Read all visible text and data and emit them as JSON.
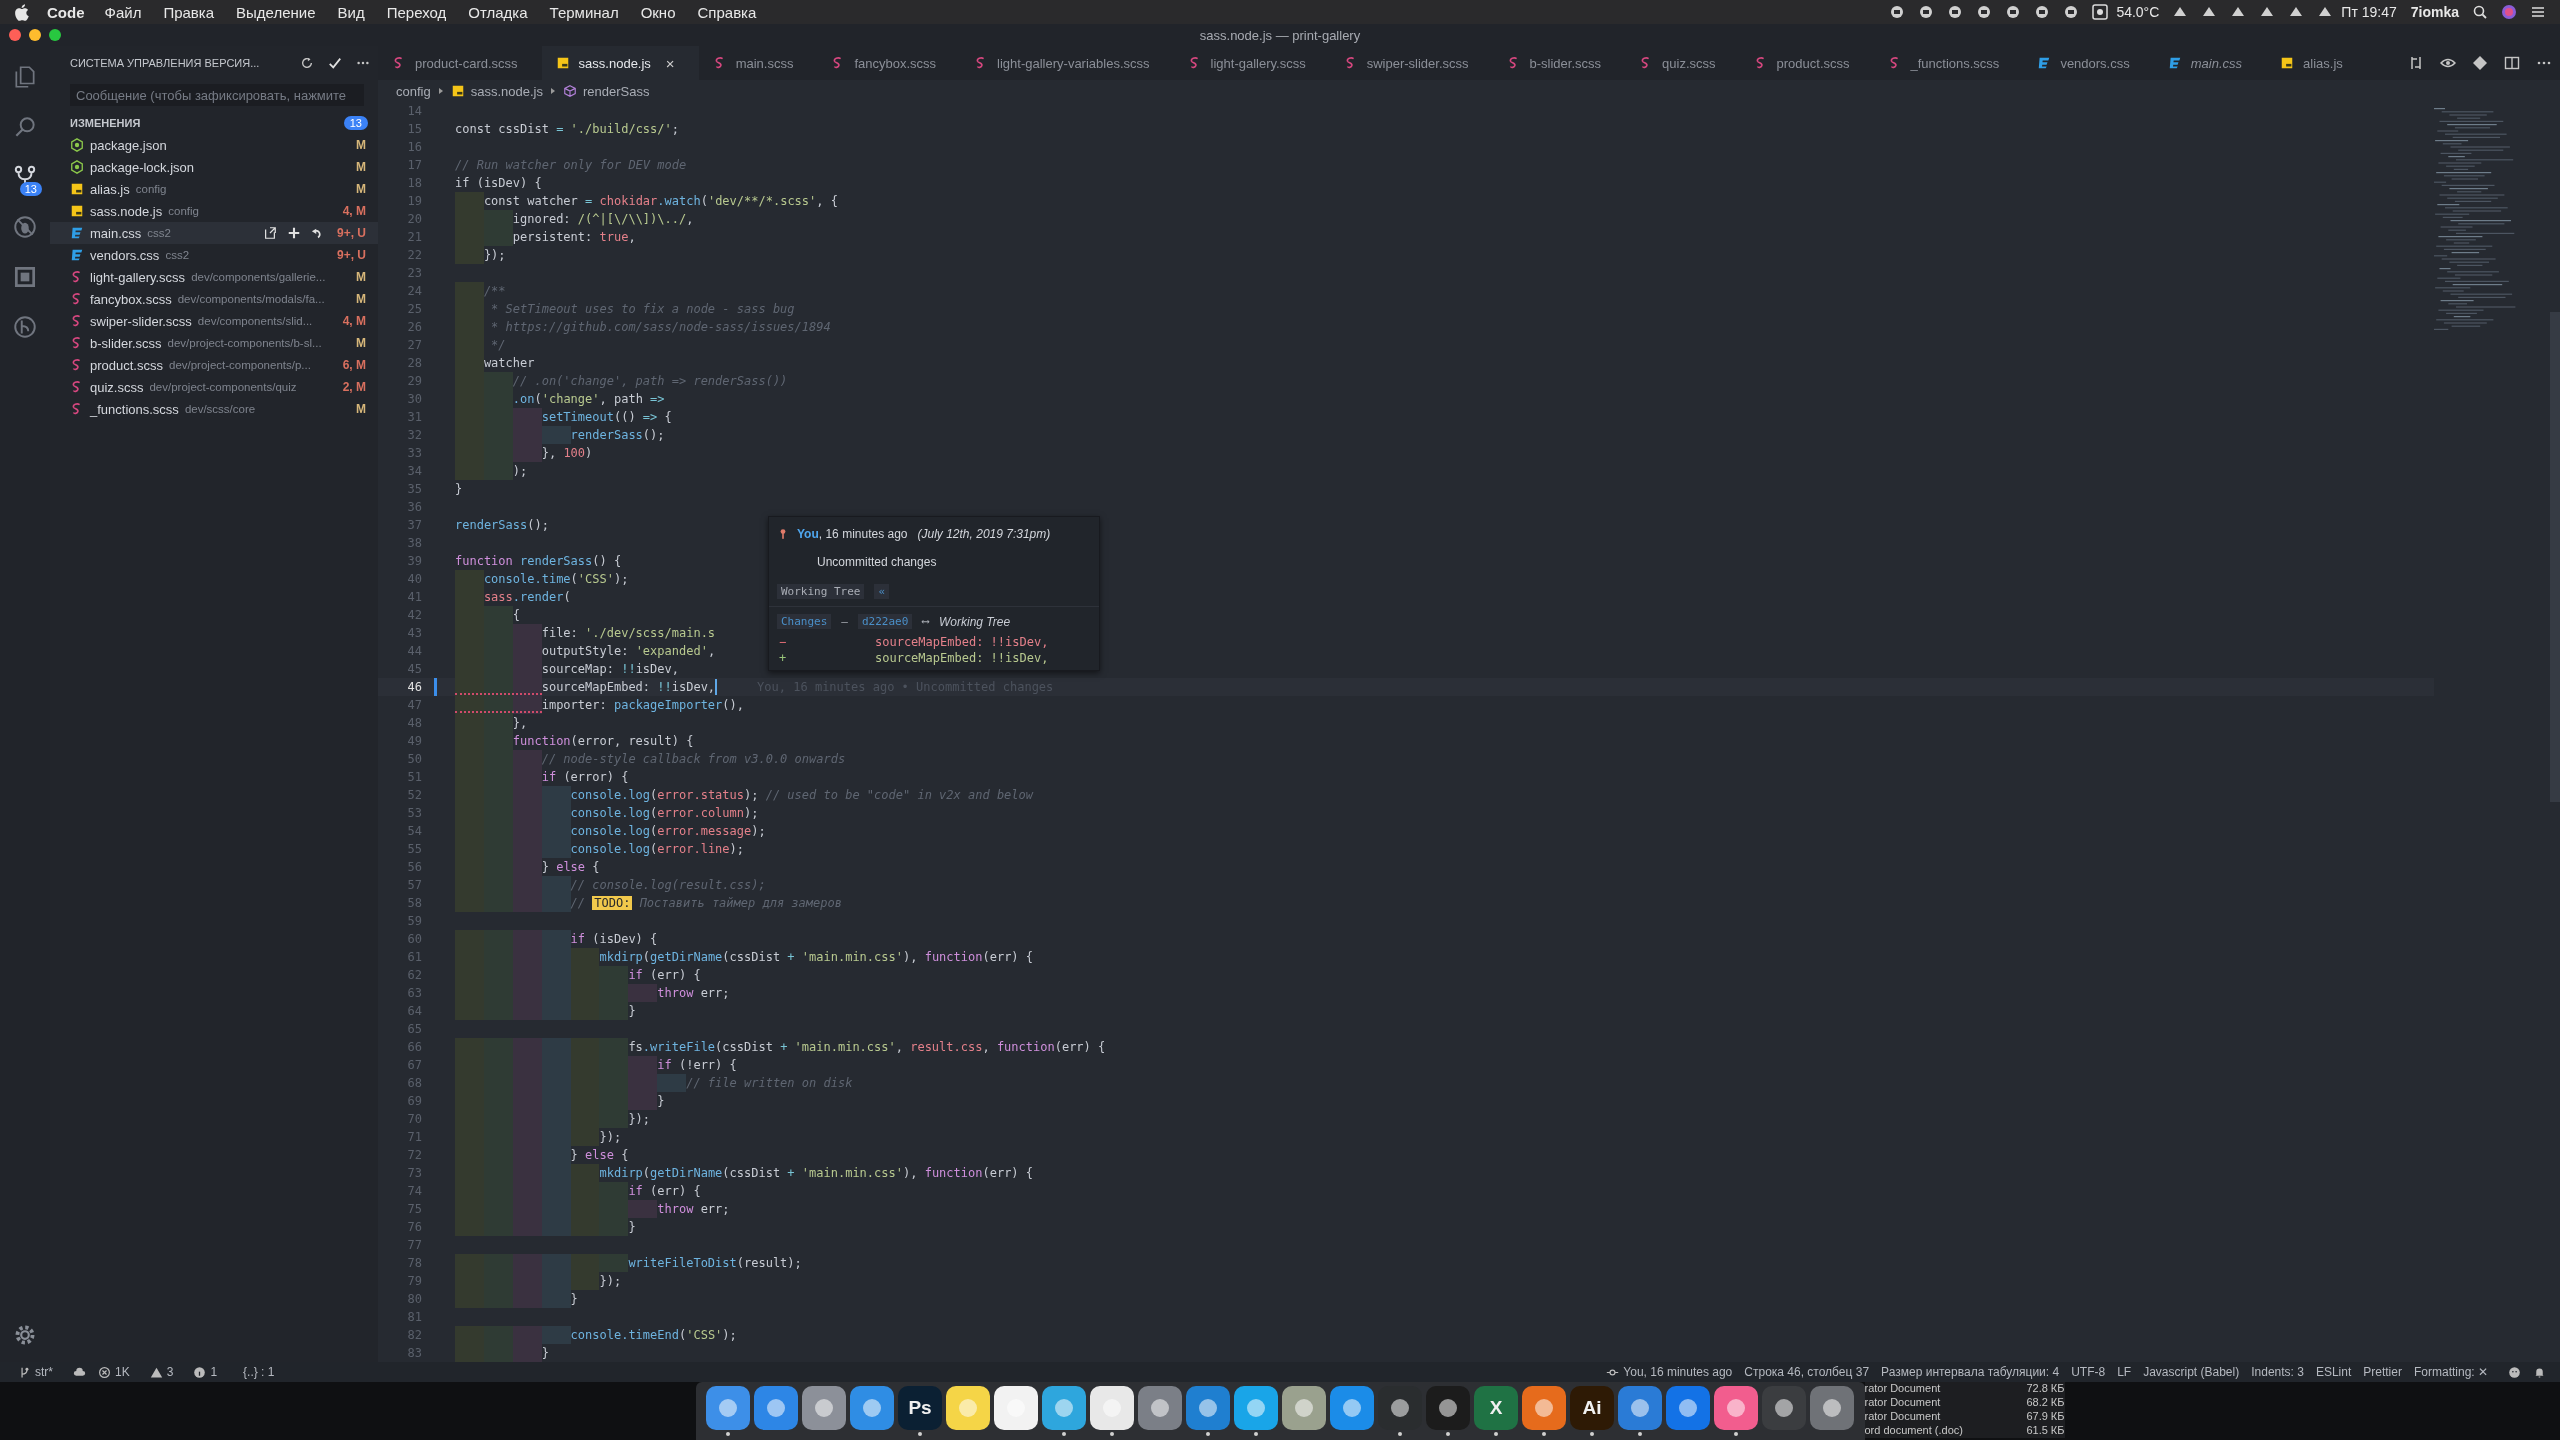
{
  "menubar": {
    "app": "Code",
    "menus": [
      "Файл",
      "Правка",
      "Выделение",
      "Вид",
      "Переход",
      "Отладка",
      "Терминал",
      "Окно",
      "Справка"
    ],
    "temperature": "54.0°C",
    "clock": "Пт 19:47",
    "user": "7iomka"
  },
  "window": {
    "title": "sass.node.js — print-gallery"
  },
  "activity_bar": {
    "items": [
      {
        "kind": "files",
        "selected": false
      },
      {
        "kind": "search",
        "selected": false
      },
      {
        "kind": "scm",
        "selected": true,
        "badge": "13"
      },
      {
        "kind": "debug",
        "selected": false
      },
      {
        "kind": "extensions",
        "selected": false
      },
      {
        "kind": "history",
        "selected": false
      }
    ]
  },
  "sidebar": {
    "title": "СИСТЕМА УПРАВЛЕНИЯ ВЕРСИЯ...",
    "message": {
      "placeholder": "Сообщение (чтобы зафиксировать, нажмите"
    },
    "section": {
      "title": "ИЗМЕНЕНИЯ",
      "count": "13"
    },
    "files": [
      {
        "name": "package.json",
        "status": "M",
        "kind": "json",
        "color": "#d7b77a",
        "selected": false
      },
      {
        "name": "package-lock.json",
        "status": "M",
        "kind": "json",
        "color": "#d7b77a",
        "selected": false
      },
      {
        "name": "alias.js",
        "path": "config",
        "status": "M",
        "kind": "js",
        "color": "#d7b77a",
        "selected": false
      },
      {
        "name": "sass.node.js",
        "path": "config",
        "status": "4, M",
        "kind": "js",
        "color": "#d9705f",
        "selected": false
      },
      {
        "name": "main.css",
        "path": "css2",
        "status": "9+, U",
        "kind": "css",
        "color": "#d9705f",
        "selected": true
      },
      {
        "name": "vendors.css",
        "path": "css2",
        "status": "9+, U",
        "kind": "css",
        "color": "#d9705f",
        "selected": false
      },
      {
        "name": "light-gallery.scss",
        "path": "dev/components/gallerie...",
        "status": "M",
        "kind": "scss",
        "color": "#d7b77a",
        "selected": false
      },
      {
        "name": "fancybox.scss",
        "path": "dev/components/modals/fa...",
        "status": "M",
        "kind": "scss",
        "color": "#d7b77a",
        "selected": false
      },
      {
        "name": "swiper-slider.scss",
        "path": "dev/components/slid...",
        "status": "4, M",
        "kind": "scss",
        "color": "#d9705f",
        "selected": false
      },
      {
        "name": "b-slider.scss",
        "path": "dev/project-components/b-sl...",
        "status": "M",
        "kind": "scss",
        "color": "#d7b77a",
        "selected": false
      },
      {
        "name": "product.scss",
        "path": "dev/project-components/p...",
        "status": "6, M",
        "kind": "scss",
        "color": "#d9705f",
        "selected": false
      },
      {
        "name": "quiz.scss",
        "path": "dev/project-components/quiz",
        "status": "2, M",
        "kind": "scss",
        "color": "#d9705f",
        "selected": false
      },
      {
        "name": "_functions.scss",
        "path": "dev/scss/core",
        "status": "M",
        "kind": "scss",
        "color": "#d7b77a",
        "selected": false
      }
    ]
  },
  "tabs": [
    {
      "label": "product-card.scss",
      "kind": "scss",
      "selected": false,
      "preview": false
    },
    {
      "label": "sass.node.js",
      "kind": "js",
      "selected": true,
      "preview": false,
      "close": "×"
    },
    {
      "label": "main.scss",
      "kind": "scss",
      "selected": false,
      "preview": false
    },
    {
      "label": "fancybox.scss",
      "kind": "scss",
      "selected": false,
      "preview": false
    },
    {
      "label": "light-gallery-variables.scss",
      "kind": "scss",
      "selected": false,
      "preview": false
    },
    {
      "label": "light-gallery.scss",
      "kind": "scss",
      "selected": false,
      "preview": false
    },
    {
      "label": "swiper-slider.scss",
      "kind": "scss",
      "selected": false,
      "preview": false
    },
    {
      "label": "b-slider.scss",
      "kind": "scss",
      "selected": false,
      "preview": false
    },
    {
      "label": "quiz.scss",
      "kind": "scss",
      "selected": false,
      "preview": false
    },
    {
      "label": "product.scss",
      "kind": "scss",
      "selected": false,
      "preview": false
    },
    {
      "label": "_functions.scss",
      "kind": "scss",
      "selected": false,
      "preview": false
    },
    {
      "label": "vendors.css",
      "kind": "css",
      "selected": false,
      "preview": false
    },
    {
      "label": "main.css",
      "kind": "css",
      "selected": false,
      "preview": true
    },
    {
      "label": "alias.js",
      "kind": "js",
      "selected": false,
      "preview": false
    }
  ],
  "breadcrumbs": [
    {
      "label": "config",
      "kind": "folder"
    },
    {
      "label": "sass.node.js",
      "kind": "js"
    },
    {
      "label": "renderSass",
      "kind": "method"
    }
  ],
  "editor": {
    "blame": "You, 16 minutes ago • Uncommitted changes",
    "lines": [
      {
        "n": "14",
        "current": false,
        "squiggle": false
      },
      {
        "n": "15",
        "current": false,
        "squiggle": false,
        "tokens": [
          {
            "kind": "plain",
            "text": "const cssDist "
          },
          {
            "kind": "operator",
            "text": "="
          },
          {
            "kind": "string",
            "text": " './build/css/'"
          },
          {
            "kind": "plain",
            "text": ";"
          }
        ]
      },
      {
        "n": "16",
        "current": false,
        "squiggle": false
      },
      {
        "n": "17",
        "current": false,
        "squiggle": false,
        "tokens": [
          {
            "kind": "comment",
            "text": "// Run watcher only for DEV mode"
          }
        ]
      },
      {
        "n": "18",
        "current": false,
        "squiggle": false,
        "tokens": [
          {
            "kind": "plain",
            "text": "if (isDev) {"
          }
        ]
      },
      {
        "n": "19",
        "current": false,
        "squiggle": false,
        "tokens": [
          {
            "kind": "plain",
            "text": "    const watcher "
          },
          {
            "kind": "operator",
            "text": "="
          },
          {
            "kind": "variable",
            "text": " chokidar"
          },
          {
            "kind": "function",
            "text": ".watch"
          },
          {
            "kind": "plain",
            "text": "("
          },
          {
            "kind": "string",
            "text": "'dev/**/*.scss'"
          },
          {
            "kind": "plain",
            "text": ", {"
          }
        ]
      },
      {
        "n": "20",
        "current": false,
        "squiggle": false,
        "tokens": [
          {
            "kind": "plain",
            "text": "        ignored: "
          },
          {
            "kind": "string",
            "text": "/(^|[\\/\\\\])\\../"
          },
          {
            "kind": "plain",
            "text": ","
          }
        ]
      },
      {
        "n": "21",
        "current": false,
        "squiggle": false,
        "tokens": [
          {
            "kind": "plain",
            "text": "        persistent: "
          },
          {
            "kind": "variable",
            "text": "true"
          },
          {
            "kind": "plain",
            "text": ","
          }
        ]
      },
      {
        "n": "22",
        "current": false,
        "squiggle": false,
        "tokens": [
          {
            "kind": "plain",
            "text": "    });"
          }
        ]
      },
      {
        "n": "23",
        "current": false,
        "squiggle": false
      },
      {
        "n": "24",
        "current": false,
        "squiggle": false,
        "tokens": [
          {
            "kind": "comment",
            "text": "    /**"
          }
        ]
      },
      {
        "n": "25",
        "current": false,
        "squiggle": false,
        "tokens": [
          {
            "kind": "comment",
            "text": "     * SetTimeout uses to fix a node - sass bug"
          }
        ]
      },
      {
        "n": "26",
        "current": false,
        "squiggle": false,
        "tokens": [
          {
            "kind": "comment",
            "text": "     * https://github.com/sass/node-sass/issues/1894"
          }
        ]
      },
      {
        "n": "27",
        "current": false,
        "squiggle": false,
        "tokens": [
          {
            "kind": "comment",
            "text": "     */"
          }
        ]
      },
      {
        "n": "28",
        "current": false,
        "squiggle": false,
        "tokens": [
          {
            "kind": "plain",
            "text": "    watcher"
          }
        ]
      },
      {
        "n": "29",
        "current": false,
        "squiggle": false,
        "tokens": [
          {
            "kind": "comment",
            "text": "        // .on('change', path => renderSass())"
          }
        ]
      },
      {
        "n": "30",
        "current": false,
        "squiggle": false,
        "tokens": [
          {
            "kind": "function",
            "text": "        .on"
          },
          {
            "kind": "plain",
            "text": "("
          },
          {
            "kind": "string",
            "text": "'change'"
          },
          {
            "kind": "plain",
            "text": ", path "
          },
          {
            "kind": "operator",
            "text": "=>"
          }
        ]
      },
      {
        "n": "31",
        "current": false,
        "squiggle": false,
        "tokens": [
          {
            "kind": "function",
            "text": "            setTimeout"
          },
          {
            "kind": "plain",
            "text": "(() "
          },
          {
            "kind": "operator",
            "text": "=>"
          },
          {
            "kind": "plain",
            "text": " {"
          }
        ]
      },
      {
        "n": "32",
        "current": false,
        "squiggle": false,
        "tokens": [
          {
            "kind": "function",
            "text": "                renderSass"
          },
          {
            "kind": "plain",
            "text": "();"
          }
        ]
      },
      {
        "n": "33",
        "current": false,
        "squiggle": false,
        "tokens": [
          {
            "kind": "plain",
            "text": "            }, "
          },
          {
            "kind": "variable",
            "text": "100"
          },
          {
            "kind": "plain",
            "text": ")"
          }
        ]
      },
      {
        "n": "34",
        "current": false,
        "squiggle": false,
        "tokens": [
          {
            "kind": "plain",
            "text": "        );"
          }
        ]
      },
      {
        "n": "35",
        "current": false,
        "squiggle": false,
        "tokens": [
          {
            "kind": "plain",
            "text": "}"
          }
        ]
      },
      {
        "n": "36",
        "current": false,
        "squiggle": false
      },
      {
        "n": "37",
        "current": false,
        "squiggle": false,
        "tokens": [
          {
            "kind": "function",
            "text": "renderSass"
          },
          {
            "kind": "plain",
            "text": "();"
          }
        ]
      },
      {
        "n": "38",
        "current": false,
        "squiggle": false
      },
      {
        "n": "39",
        "current": false,
        "squiggle": false,
        "tokens": [
          {
            "kind": "keyword",
            "text": "function"
          },
          {
            "kind": "function",
            "text": " renderSass"
          },
          {
            "kind": "plain",
            "text": "() {"
          }
        ]
      },
      {
        "n": "40",
        "current": false,
        "squiggle": false,
        "tokens": [
          {
            "kind": "function",
            "text": "    console.time"
          },
          {
            "kind": "plain",
            "text": "("
          },
          {
            "kind": "string",
            "text": "'CSS'"
          },
          {
            "kind": "plain",
            "text": ");"
          }
        ]
      },
      {
        "n": "41",
        "current": false,
        "squiggle": false,
        "tokens": [
          {
            "kind": "variable",
            "text": "    sass"
          },
          {
            "kind": "function",
            "text": ".render"
          },
          {
            "kind": "plain",
            "text": "("
          }
        ]
      },
      {
        "n": "42",
        "current": false,
        "squiggle": false,
        "tokens": [
          {
            "kind": "plain",
            "text": "        {"
          }
        ]
      },
      {
        "n": "43",
        "current": false,
        "squiggle": false,
        "tokens": [
          {
            "kind": "plain",
            "text": "            file: "
          },
          {
            "kind": "string",
            "text": "'./dev/scss/main.s"
          }
        ]
      },
      {
        "n": "44",
        "current": false,
        "squiggle": false,
        "tokens": [
          {
            "kind": "plain",
            "text": "            outputStyle: "
          },
          {
            "kind": "string",
            "text": "'expanded'"
          },
          {
            "kind": "plain",
            "text": ","
          }
        ]
      },
      {
        "n": "45",
        "current": false,
        "squiggle": false,
        "tokens": [
          {
            "kind": "plain",
            "text": "            sourceMap: "
          },
          {
            "kind": "operator",
            "text": "!!"
          },
          {
            "kind": "plain",
            "text": "isDev,"
          }
        ]
      },
      {
        "n": "46",
        "current": true,
        "squiggle": true,
        "tokens": [
          {
            "kind": "plain",
            "text": "            sourceMapEmbed: "
          },
          {
            "kind": "operator",
            "text": "!!"
          },
          {
            "kind": "plain",
            "text": "isDev,"
          }
        ]
      },
      {
        "n": "47",
        "current": false,
        "squiggle": true,
        "tokens": [
          {
            "kind": "plain",
            "text": "            importer: "
          },
          {
            "kind": "function",
            "text": "packageImporter"
          },
          {
            "kind": "plain",
            "text": "(),"
          }
        ]
      },
      {
        "n": "48",
        "current": false,
        "squiggle": false,
        "tokens": [
          {
            "kind": "plain",
            "text": "        },"
          }
        ]
      },
      {
        "n": "49",
        "current": false,
        "squiggle": false,
        "tokens": [
          {
            "kind": "keyword",
            "text": "        function"
          },
          {
            "kind": "plain",
            "text": "(error, result) {"
          }
        ]
      },
      {
        "n": "50",
        "current": false,
        "squiggle": false,
        "tokens": [
          {
            "kind": "comment",
            "text": "            // node-style callback from v3.0.0 onwards"
          }
        ]
      },
      {
        "n": "51",
        "current": false,
        "squiggle": false,
        "tokens": [
          {
            "kind": "keyword",
            "text": "            if"
          },
          {
            "kind": "plain",
            "text": " (error) {"
          }
        ]
      },
      {
        "n": "52",
        "current": false,
        "squiggle": false,
        "tokens": [
          {
            "kind": "function",
            "text": "                console.log"
          },
          {
            "kind": "plain",
            "text": "("
          },
          {
            "kind": "variable",
            "text": "error.status"
          },
          {
            "kind": "plain",
            "text": ");"
          },
          {
            "kind": "comment",
            "text": " // used to be \"code\" in v2x and below"
          }
        ]
      },
      {
        "n": "53",
        "current": false,
        "squiggle": false,
        "tokens": [
          {
            "kind": "function",
            "text": "                console.log"
          },
          {
            "kind": "plain",
            "text": "("
          },
          {
            "kind": "variable",
            "text": "error.column"
          },
          {
            "kind": "plain",
            "text": ");"
          }
        ]
      },
      {
        "n": "54",
        "current": false,
        "squiggle": false,
        "tokens": [
          {
            "kind": "function",
            "text": "                console.log"
          },
          {
            "kind": "plain",
            "text": "("
          },
          {
            "kind": "variable",
            "text": "error.message"
          },
          {
            "kind": "plain",
            "text": ");"
          }
        ]
      },
      {
        "n": "55",
        "current": false,
        "squiggle": false,
        "tokens": [
          {
            "kind": "function",
            "text": "                console.log"
          },
          {
            "kind": "plain",
            "text": "("
          },
          {
            "kind": "variable",
            "text": "error.line"
          },
          {
            "kind": "plain",
            "text": ");"
          }
        ]
      },
      {
        "n": "56",
        "current": false,
        "squiggle": false,
        "tokens": [
          {
            "kind": "plain",
            "text": "            } "
          },
          {
            "kind": "keyword",
            "text": "else"
          },
          {
            "kind": "plain",
            "text": " {"
          }
        ]
      },
      {
        "n": "57",
        "current": false,
        "squiggle": false,
        "tokens": [
          {
            "kind": "comment",
            "text": "                // console.log(result.css);"
          }
        ]
      },
      {
        "n": "58",
        "current": false,
        "squiggle": false,
        "tokens": [
          {
            "kind": "comment",
            "text": "                // "
          },
          {
            "kind": "todo",
            "text": "TODO:"
          },
          {
            "kind": "comment",
            "text": " Поставить таймер для замеров"
          }
        ]
      },
      {
        "n": "59",
        "current": false,
        "squiggle": false
      },
      {
        "n": "60",
        "current": false,
        "squiggle": false,
        "tokens": [
          {
            "kind": "keyword",
            "text": "                if"
          },
          {
            "kind": "plain",
            "text": " (isDev) {"
          }
        ]
      },
      {
        "n": "61",
        "current": false,
        "squiggle": false,
        "tokens": [
          {
            "kind": "function",
            "text": "                    mkdirp"
          },
          {
            "kind": "plain",
            "text": "("
          },
          {
            "kind": "function",
            "text": "getDirName"
          },
          {
            "kind": "plain",
            "text": "(cssDist "
          },
          {
            "kind": "operator",
            "text": "+"
          },
          {
            "kind": "string",
            "text": " 'main.min.css'"
          },
          {
            "kind": "plain",
            "text": "), "
          },
          {
            "kind": "keyword",
            "text": "function"
          },
          {
            "kind": "plain",
            "text": "(err) {"
          }
        ]
      },
      {
        "n": "62",
        "current": false,
        "squiggle": false,
        "tokens": [
          {
            "kind": "keyword",
            "text": "                        if"
          },
          {
            "kind": "plain",
            "text": " (err) {"
          }
        ]
      },
      {
        "n": "63",
        "current": false,
        "squiggle": false,
        "tokens": [
          {
            "kind": "keyword",
            "text": "                            throw"
          },
          {
            "kind": "plain",
            "text": " err;"
          }
        ]
      },
      {
        "n": "64",
        "current": false,
        "squiggle": false,
        "tokens": [
          {
            "kind": "plain",
            "text": "                        }"
          }
        ]
      },
      {
        "n": "65",
        "current": false,
        "squiggle": false
      },
      {
        "n": "66",
        "current": false,
        "squiggle": false,
        "tokens": [
          {
            "kind": "plain",
            "text": "                        fs"
          },
          {
            "kind": "function",
            "text": ".writeFile"
          },
          {
            "kind": "plain",
            "text": "(cssDist "
          },
          {
            "kind": "operator",
            "text": "+"
          },
          {
            "kind": "string",
            "text": " 'main.min.css'"
          },
          {
            "kind": "plain",
            "text": ", "
          },
          {
            "kind": "variable",
            "text": "result.css"
          },
          {
            "kind": "plain",
            "text": ", "
          },
          {
            "kind": "keyword",
            "text": "function"
          },
          {
            "kind": "plain",
            "text": "(err) {"
          }
        ]
      },
      {
        "n": "67",
        "current": false,
        "squiggle": false,
        "tokens": [
          {
            "kind": "keyword",
            "text": "                            if"
          },
          {
            "kind": "plain",
            "text": " (!err) {"
          }
        ]
      },
      {
        "n": "68",
        "current": false,
        "squiggle": false,
        "tokens": [
          {
            "kind": "comment",
            "text": "                                // file written on disk"
          }
        ]
      },
      {
        "n": "69",
        "current": false,
        "squiggle": false,
        "tokens": [
          {
            "kind": "plain",
            "text": "                            }"
          }
        ]
      },
      {
        "n": "70",
        "current": false,
        "squiggle": false,
        "tokens": [
          {
            "kind": "plain",
            "text": "                        });"
          }
        ]
      },
      {
        "n": "71",
        "current": false,
        "squiggle": false,
        "tokens": [
          {
            "kind": "plain",
            "text": "                    });"
          }
        ]
      },
      {
        "n": "72",
        "current": false,
        "squiggle": false,
        "tokens": [
          {
            "kind": "plain",
            "text": "                } "
          },
          {
            "kind": "keyword",
            "text": "else"
          },
          {
            "kind": "plain",
            "text": " {"
          }
        ]
      },
      {
        "n": "73",
        "current": false,
        "squiggle": false,
        "tokens": [
          {
            "kind": "function",
            "text": "                    mkdirp"
          },
          {
            "kind": "plain",
            "text": "("
          },
          {
            "kind": "function",
            "text": "getDirName"
          },
          {
            "kind": "plain",
            "text": "(cssDist "
          },
          {
            "kind": "operator",
            "text": "+"
          },
          {
            "kind": "string",
            "text": " 'main.min.css'"
          },
          {
            "kind": "plain",
            "text": "), "
          },
          {
            "kind": "keyword",
            "text": "function"
          },
          {
            "kind": "plain",
            "text": "(err) {"
          }
        ]
      },
      {
        "n": "74",
        "current": false,
        "squiggle": false,
        "tokens": [
          {
            "kind": "keyword",
            "text": "                        if"
          },
          {
            "kind": "plain",
            "text": " (err) {"
          }
        ]
      },
      {
        "n": "75",
        "current": false,
        "squiggle": false,
        "tokens": [
          {
            "kind": "keyword",
            "text": "                            throw"
          },
          {
            "kind": "plain",
            "text": " err;"
          }
        ]
      },
      {
        "n": "76",
        "current": false,
        "squiggle": false,
        "tokens": [
          {
            "kind": "plain",
            "text": "                        }"
          }
        ]
      },
      {
        "n": "77",
        "current": false,
        "squiggle": false
      },
      {
        "n": "78",
        "current": false,
        "squiggle": false,
        "tokens": [
          {
            "kind": "function",
            "text": "                        writeFileToDist"
          },
          {
            "kind": "plain",
            "text": "(result);"
          }
        ]
      },
      {
        "n": "79",
        "current": false,
        "squiggle": false,
        "tokens": [
          {
            "kind": "plain",
            "text": "                    });"
          }
        ]
      },
      {
        "n": "80",
        "current": false,
        "squiggle": false,
        "tokens": [
          {
            "kind": "plain",
            "text": "                }"
          }
        ]
      },
      {
        "n": "81",
        "current": false,
        "squiggle": false
      },
      {
        "n": "82",
        "current": false,
        "squiggle": false,
        "tokens": [
          {
            "kind": "function",
            "text": "                console.timeEnd"
          },
          {
            "kind": "plain",
            "text": "("
          },
          {
            "kind": "string",
            "text": "'CSS'"
          },
          {
            "kind": "plain",
            "text": ");"
          }
        ]
      },
      {
        "n": "83",
        "current": false,
        "squiggle": false,
        "tokens": [
          {
            "kind": "plain",
            "text": "            }"
          }
        ]
      }
    ]
  },
  "hover": {
    "author": "You",
    "age": ", 16 minutes ago",
    "date": "(July 12th, 2019 7:31pm)",
    "message": "Uncommitted changes",
    "ref": "Working Tree",
    "ref_button": "«",
    "changes": "Changes",
    "dash": "—",
    "sha": "d222ae0",
    "arrow": "⟷",
    "target": "Working Tree",
    "diff": [
      {
        "kind": "removed",
        "sign": "−",
        "text": "sourceMapEmbed: !!isDev,"
      },
      {
        "kind": "added",
        "sign": "+",
        "text": "sourceMapEmbed: !!isDev,"
      }
    ]
  },
  "status_bar": {
    "branch": "str*",
    "errors": "1K",
    "warnings": "3",
    "infos": "1",
    "json": "{..} : 1",
    "blame": "You, 16 minutes ago",
    "position": "Строка 46, столбец 37",
    "tab_size": "Размер интервала табуляции: 4",
    "encoding": "UTF-8",
    "eol": "LF",
    "language": "Javascript (Babel)",
    "indents": "Indents: 3",
    "eslint": "ESLint",
    "prettier": "Prettier",
    "formatting": "Formatting: ✕"
  },
  "dock": {
    "apps": [
      {
        "color": "#3d8fe8",
        "running": true
      },
      {
        "color": "#2d86e6",
        "running": false
      },
      {
        "color": "#8c9099",
        "running": false
      },
      {
        "color": "#2f8de4",
        "running": false
      },
      {
        "color": "#0b2033",
        "label": "Ps",
        "running": true
      },
      {
        "color": "#f5d547",
        "running": false
      },
      {
        "color": "#f2f2f2",
        "running": false
      },
      {
        "color": "#2ea6dd",
        "running": true
      },
      {
        "color": "#e8e8e8",
        "running": true
      },
      {
        "color": "#7b7f87",
        "running": false
      },
      {
        "color": "#1f7fd0",
        "running": true
      },
      {
        "color": "#19a5e8",
        "running": true
      },
      {
        "color": "#9aa18e",
        "running": false
      },
      {
        "color": "#1b8ce8",
        "running": false
      },
      {
        "color": "#2a2d2f",
        "running": true
      },
      {
        "color": "#1c1c1c",
        "running": true
      },
      {
        "color": "#1f7244",
        "label": "X",
        "running": true
      },
      {
        "color": "#e66b1c",
        "running": true
      },
      {
        "color": "#2e1a05",
        "label": "Ai",
        "running": true
      },
      {
        "color": "#2a7bd6",
        "running": true
      },
      {
        "color": "#1372e6",
        "running": false
      },
      {
        "color": "#f25d8e",
        "running": true
      },
      {
        "color": "#3b3d40",
        "running": false
      },
      {
        "color": "#6f7277",
        "running": false
      }
    ],
    "files": [
      {
        "description": "rator Document",
        "size": "72.8 КБ"
      },
      {
        "description": "rator Document",
        "size": "68.2 КБ"
      },
      {
        "description": "rator Document",
        "size": "67.9 КБ"
      },
      {
        "description": "ord  document (.doc)",
        "size": "61.5 КБ"
      }
    ]
  }
}
